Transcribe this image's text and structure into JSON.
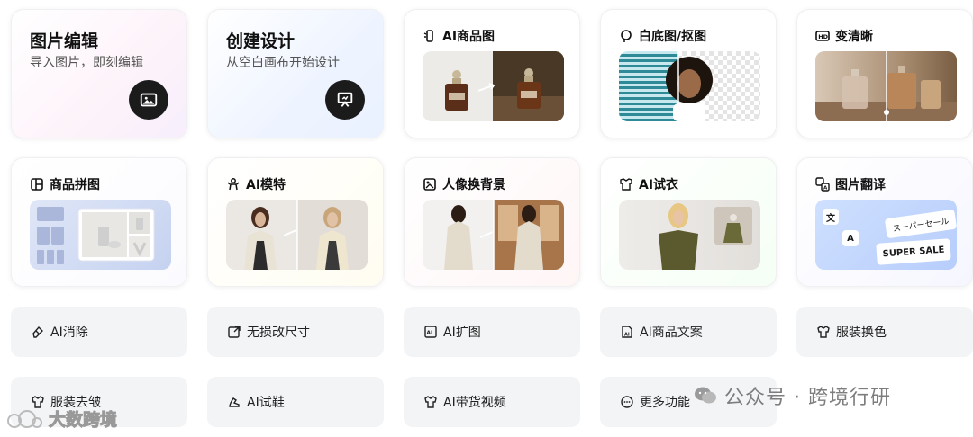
{
  "tools_top": [
    {
      "title": "图片编辑",
      "subtitle": "导入图片，即刻编辑"
    },
    {
      "title": "创建设计",
      "subtitle": "从空白画布开始设计"
    }
  ],
  "features": [
    {
      "label": "AI商品图",
      "icon": "ai-product-icon"
    },
    {
      "label": "白底图/抠图",
      "icon": "cutout-icon"
    },
    {
      "label": "变清晰",
      "icon": "hd-icon"
    },
    {
      "label": "商品拼图",
      "icon": "collage-icon"
    },
    {
      "label": "AI模特",
      "icon": "model-icon"
    },
    {
      "label": "人像换背景",
      "icon": "portrait-bg-icon"
    },
    {
      "label": "AI试衣",
      "icon": "tryon-icon"
    },
    {
      "label": "图片翻译",
      "icon": "translate-icon"
    }
  ],
  "translate_thumb": {
    "src": "文",
    "dst": "A",
    "jp": "スーパーセール",
    "en": "SUPER SALE"
  },
  "pills": [
    {
      "label": "AI消除"
    },
    {
      "label": "无损改尺寸"
    },
    {
      "label": "AI扩图"
    },
    {
      "label": "AI商品文案"
    },
    {
      "label": "服装换色"
    },
    {
      "label": "服装去皱"
    },
    {
      "label": "AI试鞋"
    },
    {
      "label": "AI带货视频"
    },
    {
      "label": "更多功能"
    }
  ],
  "watermark": {
    "left": "大数跨境",
    "right": "公众号 · 跨境行研"
  }
}
